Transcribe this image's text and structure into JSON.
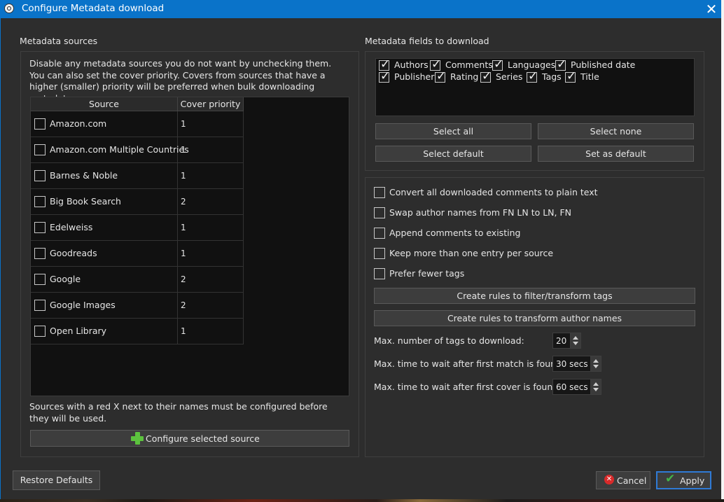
{
  "window": {
    "title": "Configure Metadata download",
    "close_glyph": "✕"
  },
  "sources": {
    "group_title": "Metadata sources",
    "description": "Disable any metadata sources you do not want by unchecking them. You can also set the cover priority. Covers from sources that have a higher (smaller) priority will be preferred when bulk downloading metadata.",
    "columns": [
      "Source",
      "Cover priority"
    ],
    "rows": [
      {
        "name": "Amazon.com",
        "priority": "1",
        "checked": false
      },
      {
        "name": "Amazon.com Multiple Countries",
        "priority": "1",
        "checked": false
      },
      {
        "name": "Barnes & Noble",
        "priority": "1",
        "checked": false
      },
      {
        "name": "Big Book Search",
        "priority": "2",
        "checked": false
      },
      {
        "name": "Edelweiss",
        "priority": "1",
        "checked": false
      },
      {
        "name": "Goodreads",
        "priority": "1",
        "checked": false
      },
      {
        "name": "Google",
        "priority": "2",
        "checked": false
      },
      {
        "name": "Google Images",
        "priority": "2",
        "checked": false
      },
      {
        "name": "Open Library",
        "priority": "1",
        "checked": false
      }
    ],
    "note": "Sources with a red X next to their names must be configured before they will be used.",
    "configure_button": "Configure selected source"
  },
  "fields": {
    "group_title": "Metadata fields to download",
    "items": [
      {
        "label": "Authors",
        "checked": true
      },
      {
        "label": "Comments",
        "checked": true
      },
      {
        "label": "Languages",
        "checked": true
      },
      {
        "label": "Published date",
        "checked": true
      },
      {
        "label": "Publisher",
        "checked": true
      },
      {
        "label": "Rating",
        "checked": true
      },
      {
        "label": "Series",
        "checked": true
      },
      {
        "label": "Tags",
        "checked": true
      },
      {
        "label": "Title",
        "checked": true
      }
    ],
    "select_all": "Select all",
    "select_none": "Select none",
    "select_default": "Select default",
    "set_as_default": "Set as default"
  },
  "options": {
    "checkboxes": [
      {
        "label": "Convert all downloaded comments to plain text",
        "checked": false
      },
      {
        "label": "Swap author names from FN LN to LN, FN",
        "checked": false
      },
      {
        "label": "Append comments to existing",
        "checked": false
      },
      {
        "label": "Keep more than one entry per source",
        "checked": false
      },
      {
        "label": "Prefer fewer tags",
        "checked": false
      }
    ],
    "tag_rules_button": "Create rules to filter/transform tags",
    "author_rules_button": "Create rules to transform author names",
    "max_tags_label": "Max. number of tags to download:",
    "max_tags_value": "20",
    "wait_match_label": "Max. time to wait after first match is found:",
    "wait_match_value": "30 secs",
    "wait_cover_label": "Max. time to wait after first cover is found:",
    "wait_cover_value": "60 secs"
  },
  "footer": {
    "restore_defaults": "Restore Defaults",
    "cancel": "Cancel",
    "apply": "Apply"
  },
  "colors": {
    "title_bar": "#0a73c9",
    "background": "#2d2d2d",
    "list_background": "#111111",
    "configure_icon": "#5cc23e",
    "cancel_icon": "#d92a2a",
    "apply_icon": "#43b34a",
    "apply_border": "#2f7bd6"
  },
  "icons": [
    "app-icon",
    "close-icon",
    "plus-icon",
    "cancel-x-icon",
    "apply-check-icon"
  ]
}
